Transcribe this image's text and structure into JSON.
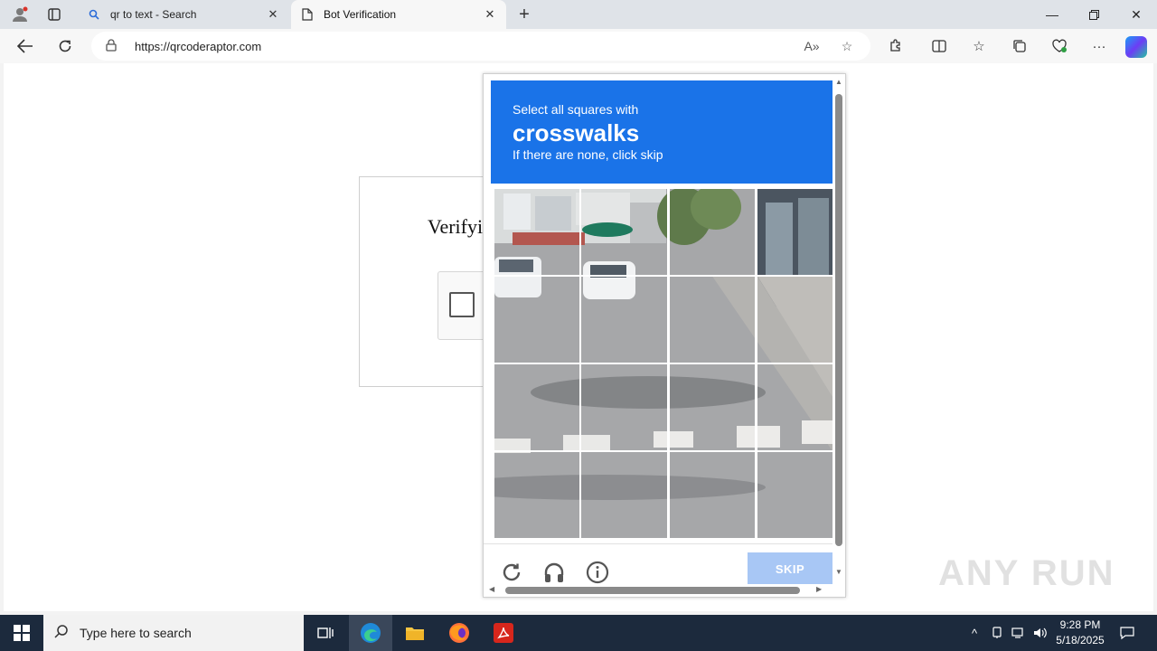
{
  "browser": {
    "tabs": [
      {
        "label": "qr to text - Search",
        "favicon": "search-icon"
      },
      {
        "label": "Bot Verification",
        "favicon": "page-icon"
      }
    ],
    "url": "https://qrcoderaptor.com"
  },
  "page": {
    "verify_title": "Verifyi"
  },
  "captcha": {
    "prompt_line1": "Select all squares with",
    "prompt_target": "crosswalks",
    "prompt_line3": "If there are none, click skip",
    "skip_label": "SKIP",
    "accent_color": "#1a73e8"
  },
  "watermark": "ANY RUN",
  "taskbar": {
    "search_placeholder": "Type here to search",
    "time": "9:28 PM",
    "date": "5/18/2025"
  }
}
